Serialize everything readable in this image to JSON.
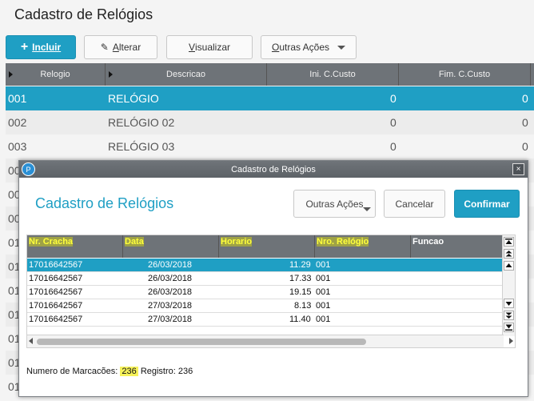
{
  "page": {
    "title": "Cadastro de Relógios"
  },
  "toolbar": {
    "incluir": "Incluir",
    "alterar_a": "A",
    "alterar_rest": "lterar",
    "visualizar_v": "V",
    "visualizar_rest": "isualizar",
    "outras_o": "O",
    "outras_rest": "utras Ações"
  },
  "grid": {
    "headers": [
      "Relogio",
      "Descricao",
      "Ini. C.Custo",
      "Fim. C.Custo"
    ],
    "rows": [
      {
        "codigo": "001",
        "descricao": "RELÓGIO",
        "ini": "0",
        "fim": "0"
      },
      {
        "codigo": "002",
        "descricao": "RELÓGIO 02",
        "ini": "0",
        "fim": "0"
      },
      {
        "codigo": "003",
        "descricao": "RELÓGIO 03",
        "ini": "0",
        "fim": "0"
      }
    ],
    "hidden_prefixes": [
      "00",
      "00",
      "00",
      "01",
      "01",
      "01",
      "01",
      "01",
      "01",
      "01"
    ]
  },
  "dialog": {
    "title": "Cadastro de Relógios",
    "heading": "Cadastro de Relógios",
    "logo": "P",
    "close": "×",
    "outras_acoes": "Outras Ações",
    "cancelar": "Cancelar",
    "confirmar": "Confirmar",
    "headers": [
      "Nr. Cracha",
      "Data",
      "Horario",
      "Nro. Relógio",
      "Funcao"
    ],
    "rows": [
      {
        "cracha": "17016642567",
        "data": "26/03/2018",
        "horario": "11.29",
        "relogio": "001"
      },
      {
        "cracha": "17016642567",
        "data": "26/03/2018",
        "horario": "17.33",
        "relogio": "001"
      },
      {
        "cracha": "17016642567",
        "data": "26/03/2018",
        "horario": "19.15",
        "relogio": "001"
      },
      {
        "cracha": "17016642567",
        "data": "27/03/2018",
        "horario": "8.13",
        "relogio": "001"
      },
      {
        "cracha": "17016642567",
        "data": "27/03/2018",
        "horario": "11.40",
        "relogio": "001"
      }
    ],
    "status_prefix": "Numero de Marcacões:",
    "marcacoes": "236",
    "registro_label": "Registro:",
    "registro": "236"
  },
  "colors": {
    "accent": "#1f9fc4",
    "header": "#6e7378",
    "highlight": "#f6f25a"
  }
}
